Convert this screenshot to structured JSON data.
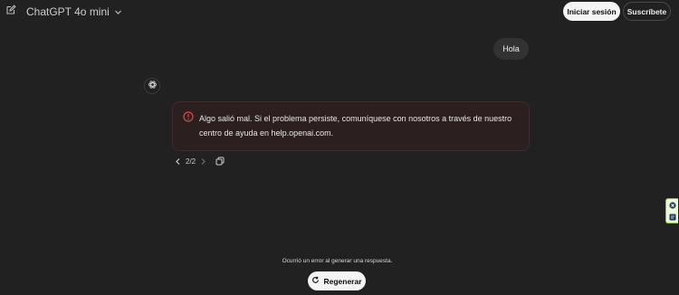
{
  "header": {
    "model_name": "ChatGPT 4o mini",
    "login_label": "Iniciar sesión",
    "signup_label": "Suscríbete"
  },
  "conversation": {
    "user_message": "Hola",
    "error_message": "Algo salió mal. Si el problema persiste, comuníquese con nosotros a través de nuestro centro de ayuda en help.openai.com.",
    "pagination": "2/2"
  },
  "footer": {
    "error_notice": "Ocurrió un error al generar una respuesta.",
    "regenerate_label": "Regenerar"
  },
  "colors": {
    "background": "#212121",
    "error_accent": "#e04848",
    "primary_button": "#f4f4f4"
  },
  "icons": [
    "edit-icon",
    "chevron-down-icon",
    "openai-logo-icon",
    "alert-circle-icon",
    "chevron-left-icon",
    "chevron-right-icon",
    "copy-icon",
    "refresh-icon",
    "close-icon",
    "page-icon"
  ]
}
